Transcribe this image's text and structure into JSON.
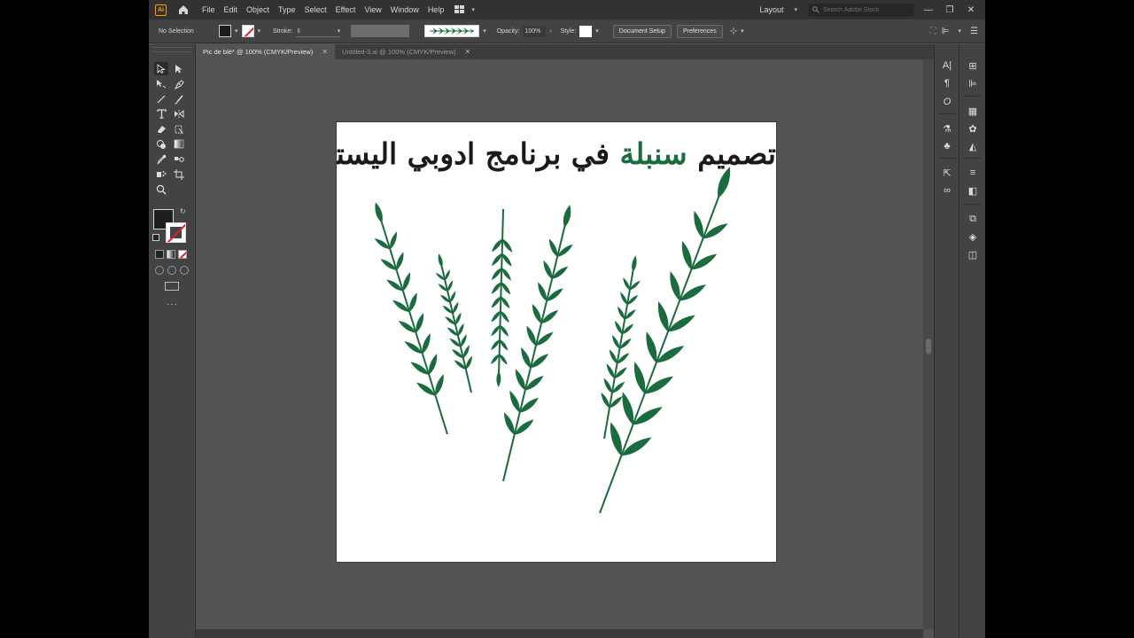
{
  "app": {
    "logo": "Ai"
  },
  "menu": [
    "File",
    "Edit",
    "Object",
    "Type",
    "Select",
    "Effect",
    "View",
    "Window",
    "Help"
  ],
  "workspace": "Layout",
  "search": {
    "placeholder": "Search Adobe Stock"
  },
  "control": {
    "selection": "No Selection",
    "stroke_label": "Stroke:",
    "opacity_label": "Opacity:",
    "opacity_value": "100%",
    "style_label": "Style:",
    "doc_setup": "Document Setup",
    "preferences": "Preferences"
  },
  "tabs": [
    {
      "label": "Pic de blé* @ 100% (CMYK/Preview)",
      "active": true
    },
    {
      "label": "Untitled-3.ai @ 100% (CMYK/Preview)",
      "active": false
    }
  ],
  "artboard": {
    "title_part1": "تصميم ",
    "title_accent": "سنبلة",
    "title_part2": " في برنامج ادوبي اليستريتور"
  },
  "colors": {
    "leaf": "#1a6b3e",
    "accent": "#1a6b3e",
    "bg": "#535353"
  }
}
